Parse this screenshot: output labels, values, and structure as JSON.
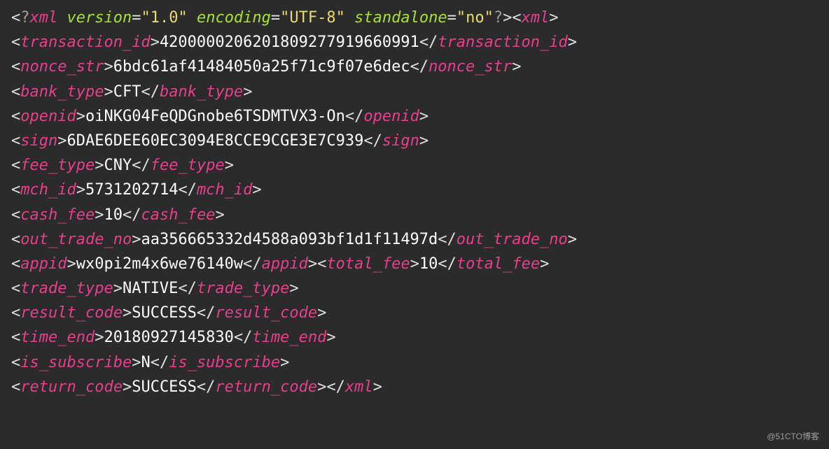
{
  "xml_decl": {
    "target": "xml",
    "attrs": [
      {
        "name": "version",
        "value": "\"1.0\""
      },
      {
        "name": "encoding",
        "value": "\"UTF-8\""
      },
      {
        "name": "standalone",
        "value": "\"no\""
      }
    ]
  },
  "root": "xml",
  "elements": [
    {
      "tag": "transaction_id",
      "value": "4200000206201809277919660991"
    },
    {
      "tag": "nonce_str",
      "value": "6bdc61af41484050a25f71c9f07e6dec"
    },
    {
      "tag": "bank_type",
      "value": "CFT"
    },
    {
      "tag": "openid",
      "value": "oiNKG04FeQDGnobe6TSDMTVX3-On"
    },
    {
      "tag": "sign",
      "value": "6DAE6DEE60EC3094E8CCE9CGE3E7C939"
    },
    {
      "tag": "fee_type",
      "value": "CNY"
    },
    {
      "tag": "mch_id",
      "value": "5731202714"
    },
    {
      "tag": "cash_fee",
      "value": "10"
    },
    {
      "tag": "out_trade_no",
      "value": "aa356665332d4588a093bf1d1f11497d"
    },
    {
      "tag": "appid",
      "value": "wx0pi2m4x6we76140w",
      "inline_next": true
    },
    {
      "tag": "total_fee",
      "value": "10"
    },
    {
      "tag": "trade_type",
      "value": "NATIVE"
    },
    {
      "tag": "result_code",
      "value": "SUCCESS"
    },
    {
      "tag": "time_end",
      "value": "20180927145830"
    },
    {
      "tag": "is_subscribe",
      "value": "N"
    },
    {
      "tag": "return_code",
      "value": "SUCCESS",
      "close_root_inline": true
    }
  ],
  "watermark": "@51CTO博客"
}
